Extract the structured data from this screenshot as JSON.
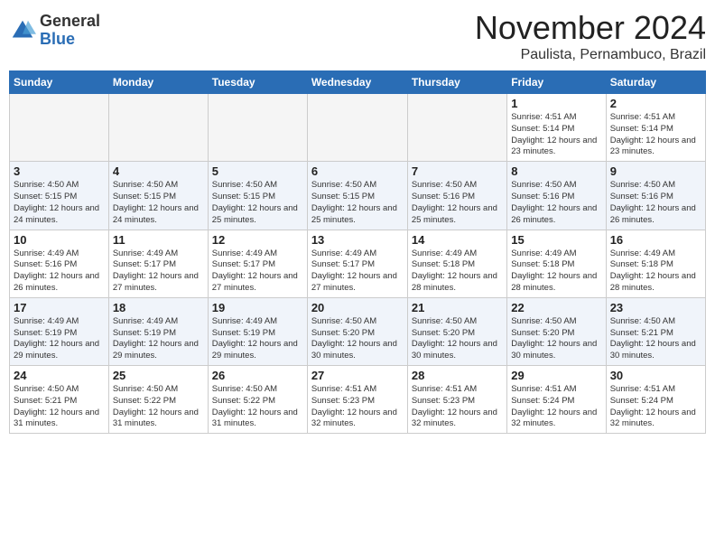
{
  "logo": {
    "general": "General",
    "blue": "Blue"
  },
  "header": {
    "month": "November 2024",
    "location": "Paulista, Pernambuco, Brazil"
  },
  "weekdays": [
    "Sunday",
    "Monday",
    "Tuesday",
    "Wednesday",
    "Thursday",
    "Friday",
    "Saturday"
  ],
  "weeks": [
    [
      {
        "day": "",
        "empty": true
      },
      {
        "day": "",
        "empty": true
      },
      {
        "day": "",
        "empty": true
      },
      {
        "day": "",
        "empty": true
      },
      {
        "day": "",
        "empty": true
      },
      {
        "day": "1",
        "sunrise": "Sunrise: 4:51 AM",
        "sunset": "Sunset: 5:14 PM",
        "daylight": "Daylight: 12 hours and 23 minutes."
      },
      {
        "day": "2",
        "sunrise": "Sunrise: 4:51 AM",
        "sunset": "Sunset: 5:14 PM",
        "daylight": "Daylight: 12 hours and 23 minutes."
      }
    ],
    [
      {
        "day": "3",
        "sunrise": "Sunrise: 4:50 AM",
        "sunset": "Sunset: 5:15 PM",
        "daylight": "Daylight: 12 hours and 24 minutes."
      },
      {
        "day": "4",
        "sunrise": "Sunrise: 4:50 AM",
        "sunset": "Sunset: 5:15 PM",
        "daylight": "Daylight: 12 hours and 24 minutes."
      },
      {
        "day": "5",
        "sunrise": "Sunrise: 4:50 AM",
        "sunset": "Sunset: 5:15 PM",
        "daylight": "Daylight: 12 hours and 25 minutes."
      },
      {
        "day": "6",
        "sunrise": "Sunrise: 4:50 AM",
        "sunset": "Sunset: 5:15 PM",
        "daylight": "Daylight: 12 hours and 25 minutes."
      },
      {
        "day": "7",
        "sunrise": "Sunrise: 4:50 AM",
        "sunset": "Sunset: 5:16 PM",
        "daylight": "Daylight: 12 hours and 25 minutes."
      },
      {
        "day": "8",
        "sunrise": "Sunrise: 4:50 AM",
        "sunset": "Sunset: 5:16 PM",
        "daylight": "Daylight: 12 hours and 26 minutes."
      },
      {
        "day": "9",
        "sunrise": "Sunrise: 4:50 AM",
        "sunset": "Sunset: 5:16 PM",
        "daylight": "Daylight: 12 hours and 26 minutes."
      }
    ],
    [
      {
        "day": "10",
        "sunrise": "Sunrise: 4:49 AM",
        "sunset": "Sunset: 5:16 PM",
        "daylight": "Daylight: 12 hours and 26 minutes."
      },
      {
        "day": "11",
        "sunrise": "Sunrise: 4:49 AM",
        "sunset": "Sunset: 5:17 PM",
        "daylight": "Daylight: 12 hours and 27 minutes."
      },
      {
        "day": "12",
        "sunrise": "Sunrise: 4:49 AM",
        "sunset": "Sunset: 5:17 PM",
        "daylight": "Daylight: 12 hours and 27 minutes."
      },
      {
        "day": "13",
        "sunrise": "Sunrise: 4:49 AM",
        "sunset": "Sunset: 5:17 PM",
        "daylight": "Daylight: 12 hours and 27 minutes."
      },
      {
        "day": "14",
        "sunrise": "Sunrise: 4:49 AM",
        "sunset": "Sunset: 5:18 PM",
        "daylight": "Daylight: 12 hours and 28 minutes."
      },
      {
        "day": "15",
        "sunrise": "Sunrise: 4:49 AM",
        "sunset": "Sunset: 5:18 PM",
        "daylight": "Daylight: 12 hours and 28 minutes."
      },
      {
        "day": "16",
        "sunrise": "Sunrise: 4:49 AM",
        "sunset": "Sunset: 5:18 PM",
        "daylight": "Daylight: 12 hours and 28 minutes."
      }
    ],
    [
      {
        "day": "17",
        "sunrise": "Sunrise: 4:49 AM",
        "sunset": "Sunset: 5:19 PM",
        "daylight": "Daylight: 12 hours and 29 minutes."
      },
      {
        "day": "18",
        "sunrise": "Sunrise: 4:49 AM",
        "sunset": "Sunset: 5:19 PM",
        "daylight": "Daylight: 12 hours and 29 minutes."
      },
      {
        "day": "19",
        "sunrise": "Sunrise: 4:49 AM",
        "sunset": "Sunset: 5:19 PM",
        "daylight": "Daylight: 12 hours and 29 minutes."
      },
      {
        "day": "20",
        "sunrise": "Sunrise: 4:50 AM",
        "sunset": "Sunset: 5:20 PM",
        "daylight": "Daylight: 12 hours and 30 minutes."
      },
      {
        "day": "21",
        "sunrise": "Sunrise: 4:50 AM",
        "sunset": "Sunset: 5:20 PM",
        "daylight": "Daylight: 12 hours and 30 minutes."
      },
      {
        "day": "22",
        "sunrise": "Sunrise: 4:50 AM",
        "sunset": "Sunset: 5:20 PM",
        "daylight": "Daylight: 12 hours and 30 minutes."
      },
      {
        "day": "23",
        "sunrise": "Sunrise: 4:50 AM",
        "sunset": "Sunset: 5:21 PM",
        "daylight": "Daylight: 12 hours and 30 minutes."
      }
    ],
    [
      {
        "day": "24",
        "sunrise": "Sunrise: 4:50 AM",
        "sunset": "Sunset: 5:21 PM",
        "daylight": "Daylight: 12 hours and 31 minutes."
      },
      {
        "day": "25",
        "sunrise": "Sunrise: 4:50 AM",
        "sunset": "Sunset: 5:22 PM",
        "daylight": "Daylight: 12 hours and 31 minutes."
      },
      {
        "day": "26",
        "sunrise": "Sunrise: 4:50 AM",
        "sunset": "Sunset: 5:22 PM",
        "daylight": "Daylight: 12 hours and 31 minutes."
      },
      {
        "day": "27",
        "sunrise": "Sunrise: 4:51 AM",
        "sunset": "Sunset: 5:23 PM",
        "daylight": "Daylight: 12 hours and 32 minutes."
      },
      {
        "day": "28",
        "sunrise": "Sunrise: 4:51 AM",
        "sunset": "Sunset: 5:23 PM",
        "daylight": "Daylight: 12 hours and 32 minutes."
      },
      {
        "day": "29",
        "sunrise": "Sunrise: 4:51 AM",
        "sunset": "Sunset: 5:24 PM",
        "daylight": "Daylight: 12 hours and 32 minutes."
      },
      {
        "day": "30",
        "sunrise": "Sunrise: 4:51 AM",
        "sunset": "Sunset: 5:24 PM",
        "daylight": "Daylight: 12 hours and 32 minutes."
      }
    ]
  ]
}
